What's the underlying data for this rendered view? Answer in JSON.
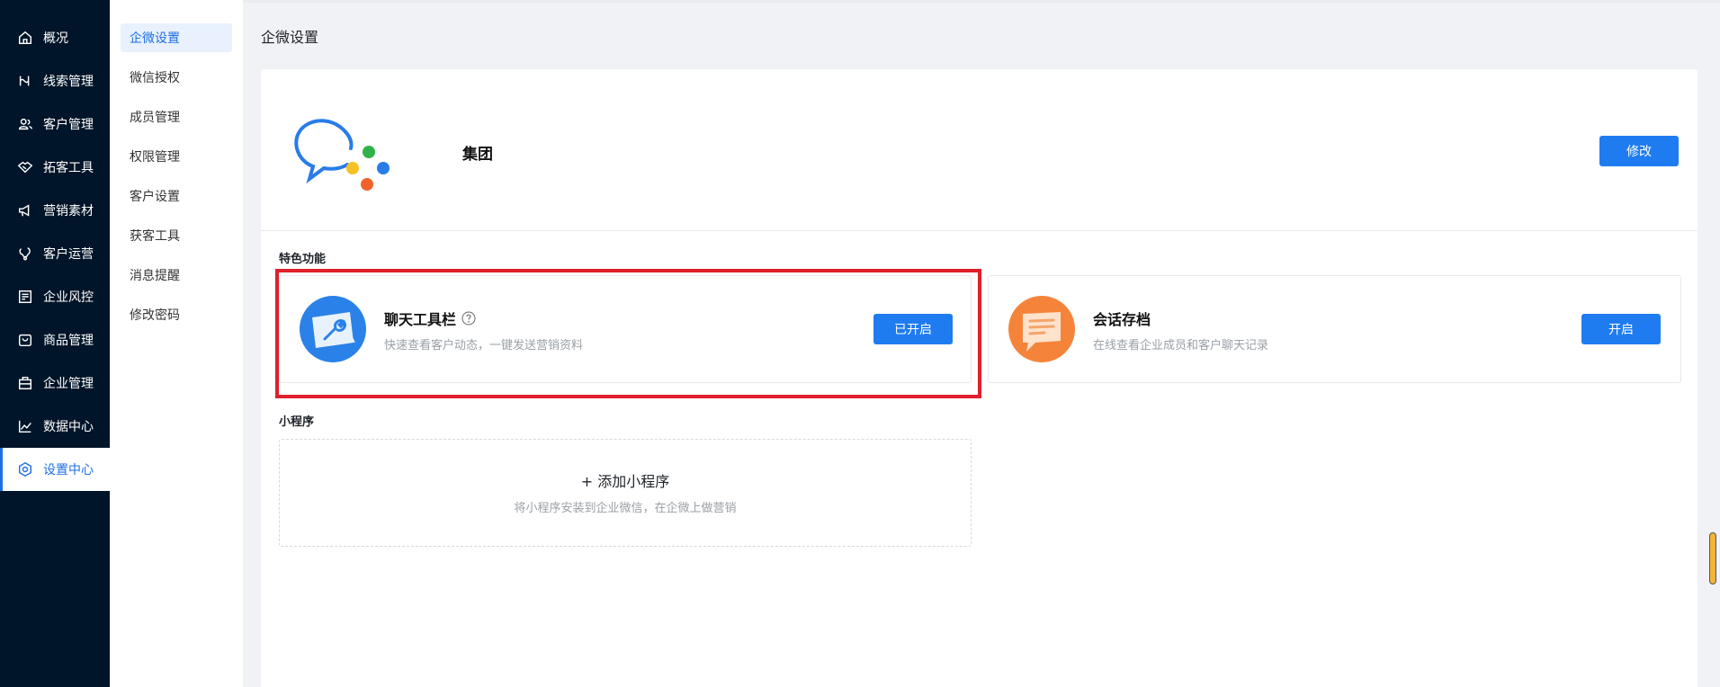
{
  "sidebar": {
    "items": [
      {
        "label": "概况",
        "icon": "home-icon"
      },
      {
        "label": "线索管理",
        "icon": "funnel-icon"
      },
      {
        "label": "客户管理",
        "icon": "users-icon"
      },
      {
        "label": "拓客工具",
        "icon": "handshake-icon"
      },
      {
        "label": "营销素材",
        "icon": "megaphone-icon"
      },
      {
        "label": "客户运营",
        "icon": "operation-icon"
      },
      {
        "label": "企业风控",
        "icon": "document-icon"
      },
      {
        "label": "商品管理",
        "icon": "bag-icon"
      },
      {
        "label": "企业管理",
        "icon": "briefcase-icon"
      },
      {
        "label": "数据中心",
        "icon": "chart-line-icon"
      },
      {
        "label": "设置中心",
        "icon": "settings-icon",
        "active": true
      }
    ]
  },
  "submenu": {
    "items": [
      {
        "label": "企微设置",
        "active": true
      },
      {
        "label": "微信授权"
      },
      {
        "label": "成员管理"
      },
      {
        "label": "权限管理"
      },
      {
        "label": "客户设置"
      },
      {
        "label": "获客工具"
      },
      {
        "label": "消息提醒"
      },
      {
        "label": "修改密码"
      }
    ]
  },
  "main": {
    "title": "企微设置",
    "corp": {
      "name": "集团",
      "modify_label": "修改"
    },
    "features_label": "特色功能",
    "features": [
      {
        "title": "聊天工具栏",
        "desc": "快速查看客户动态，一键发送营销资料",
        "button": "已开启",
        "icon": "wrench-chat-icon"
      },
      {
        "title": "会话存档",
        "desc": "在线查看企业成员和客户聊天记录",
        "button": "开启",
        "icon": "archive-chat-icon"
      }
    ],
    "miniprogram_label": "小程序",
    "miniprogram": {
      "add_label": "+ 添加小程序",
      "desc": "将小程序安装到企业微信，在企微上做营销"
    }
  },
  "colors": {
    "sidebar_bg": "#001529",
    "accent": "#1f7cf0",
    "highlight": "#e0202a",
    "orange": "#f5843a"
  }
}
